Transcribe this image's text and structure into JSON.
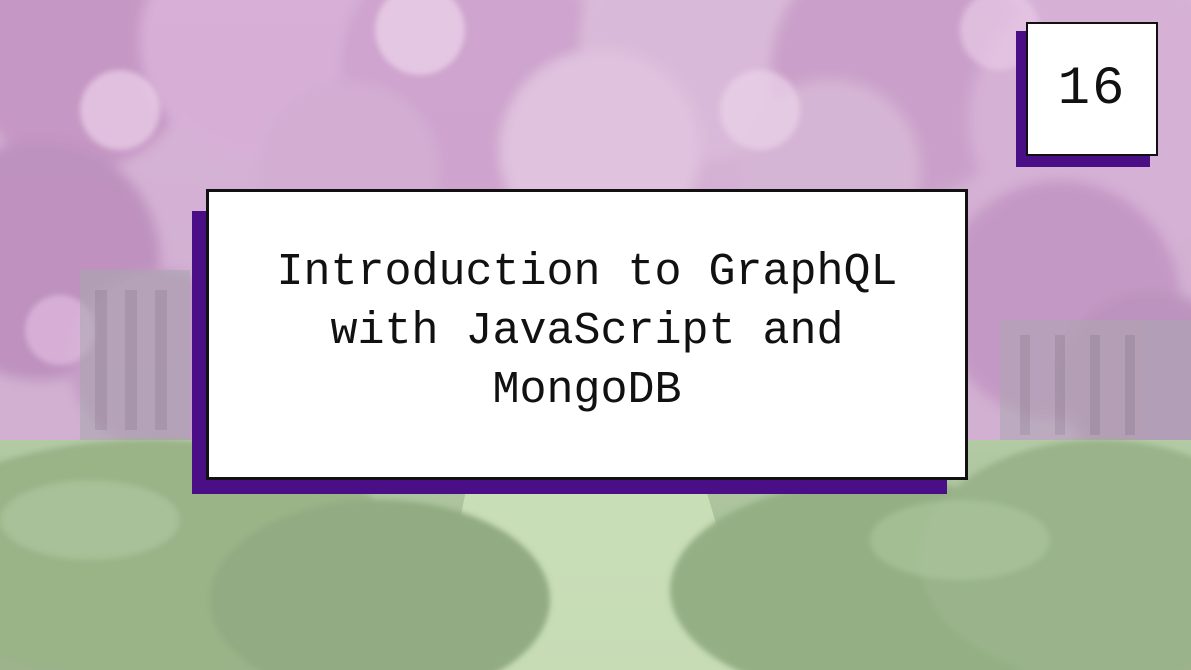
{
  "background": {
    "description_icon": "flowering-trees-garden-path-icon",
    "colors": {
      "blossom": "#b47ab8",
      "blossom_light": "#d7a6d2",
      "hedge": "#6f9455",
      "path": "#a9c98a",
      "accent": "#4a0f86"
    }
  },
  "badge": {
    "number": "16"
  },
  "title": {
    "lines": [
      "Introduction to GraphQL",
      "with JavaScript and",
      "MongoDB"
    ]
  }
}
